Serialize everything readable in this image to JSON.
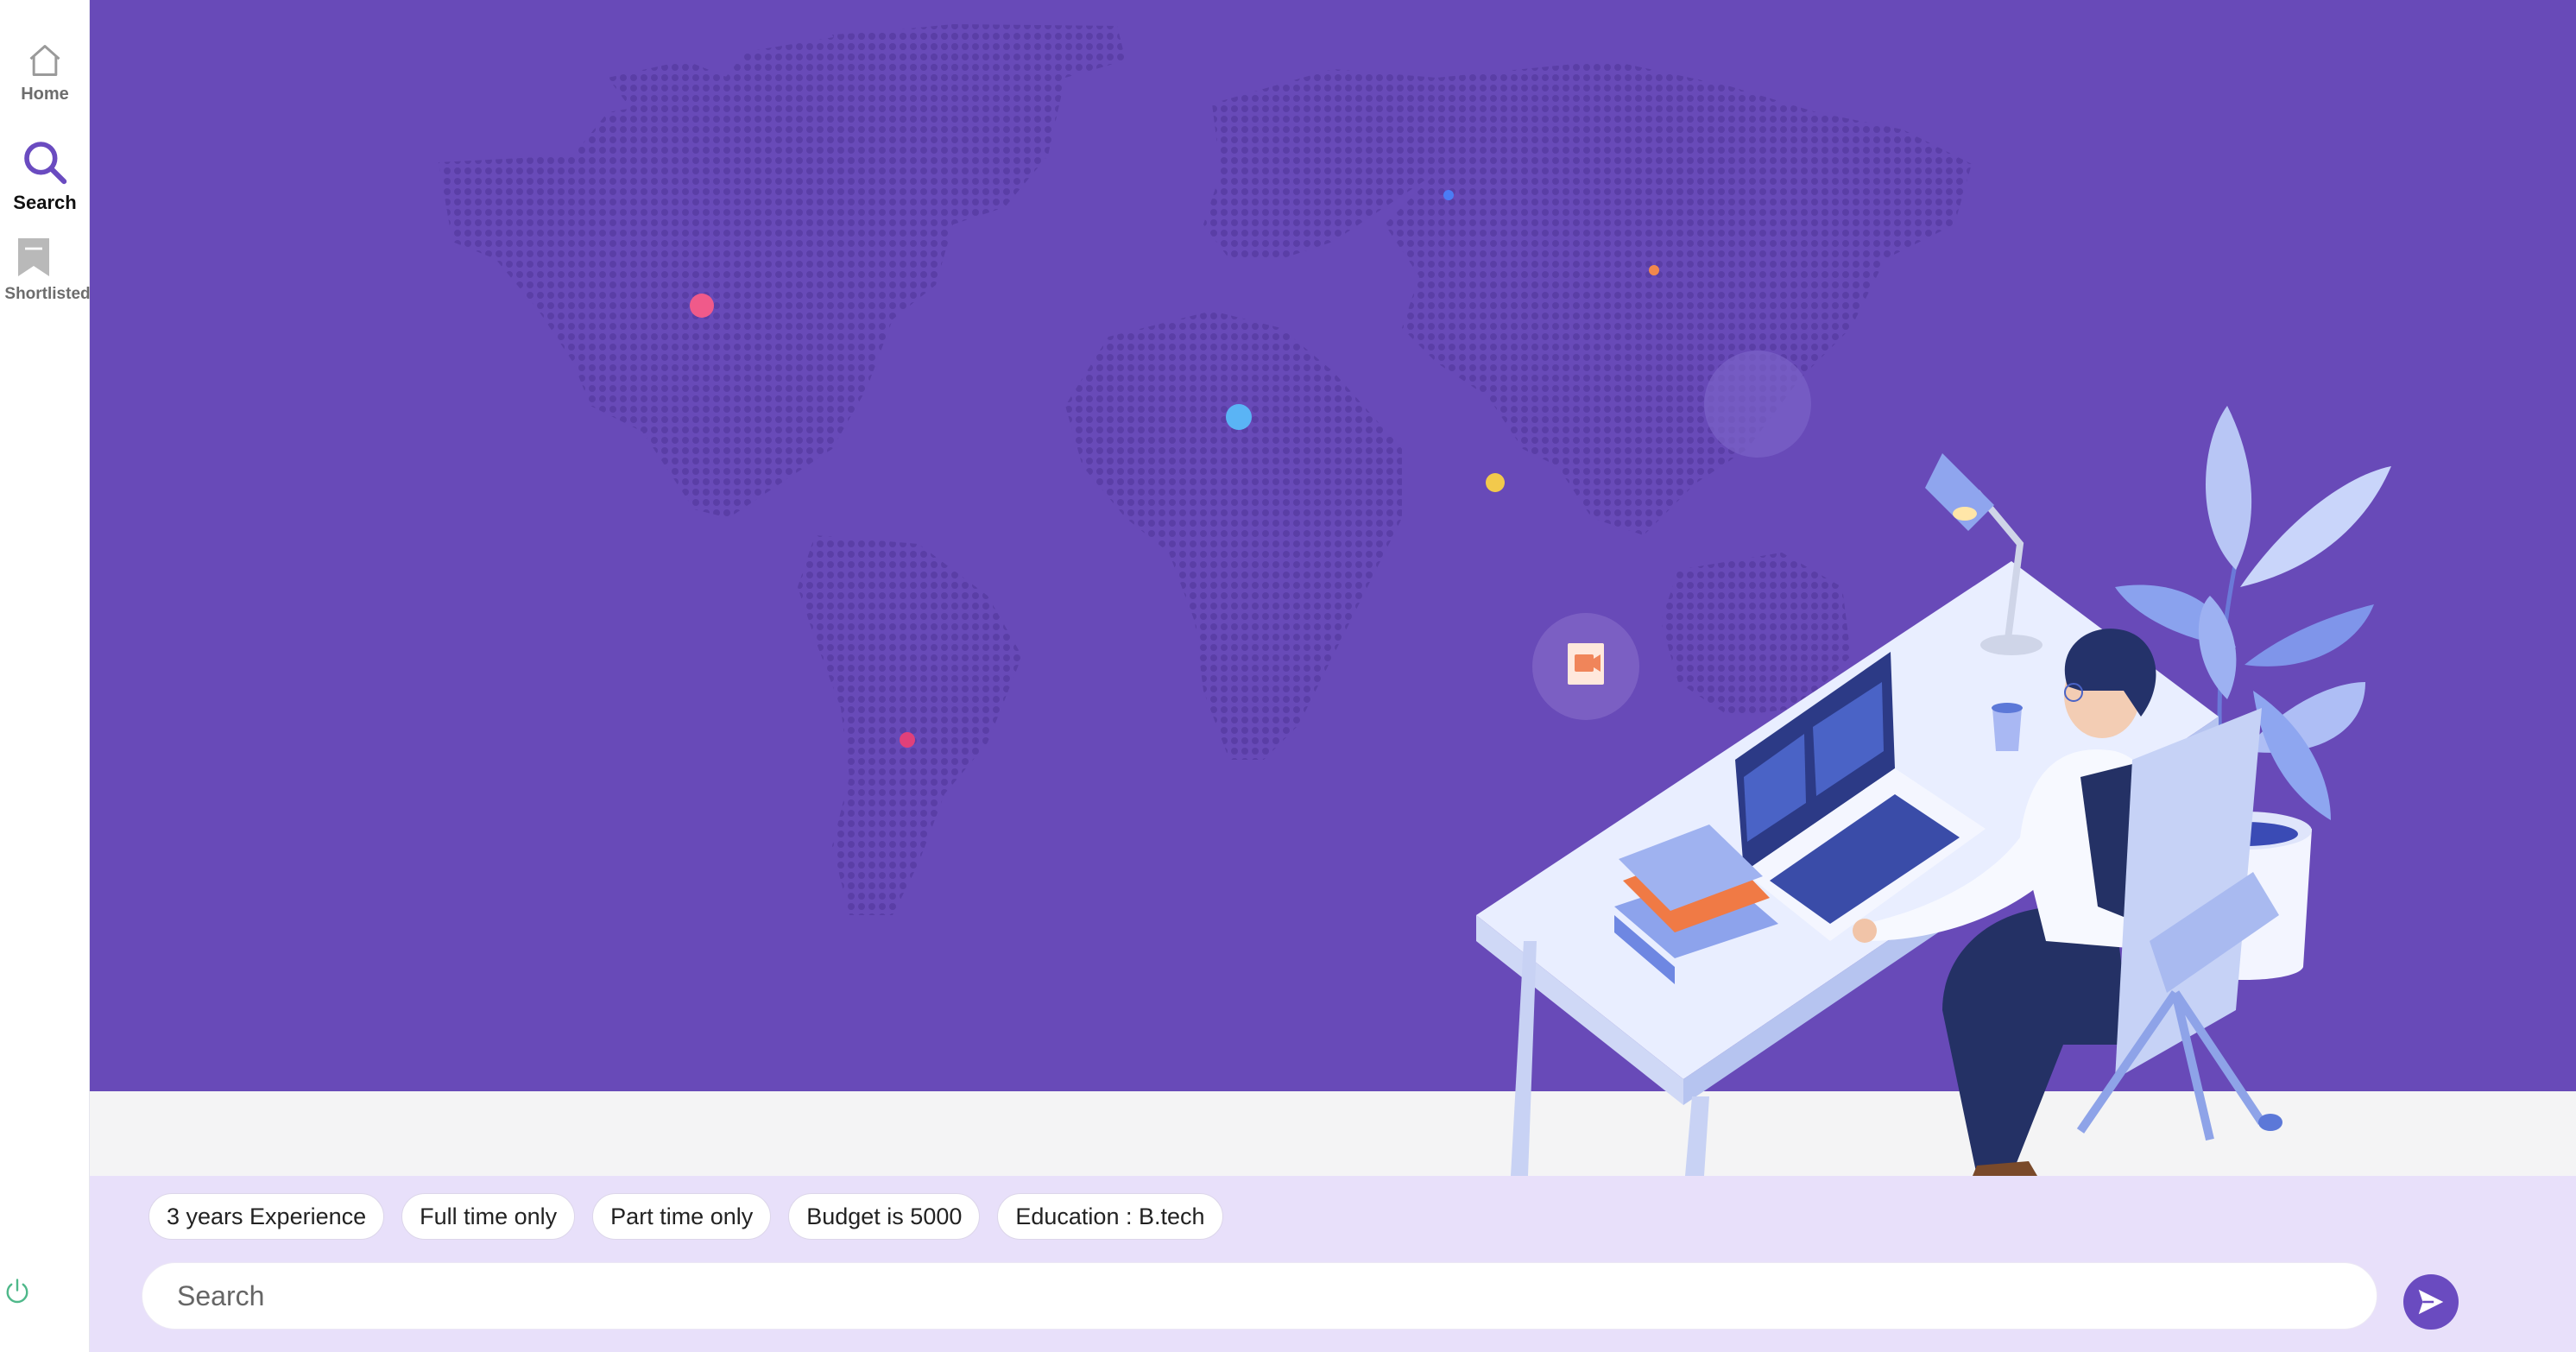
{
  "nav": {
    "home": {
      "label": "Home",
      "icon": "home-icon"
    },
    "search": {
      "label": "Search",
      "icon": "search-icon",
      "active": true
    },
    "shortlisted": {
      "label": "Shortlisted",
      "icon": "bookmark-icon"
    }
  },
  "power": {
    "icon": "power-icon"
  },
  "colors": {
    "hero_bg": "#684ab8",
    "accent": "#6a4bc0",
    "panel_bg": "#e8e0fa",
    "map_dot": "#5a3ea6"
  },
  "filters": [
    {
      "label": "3 years Experience"
    },
    {
      "label": "Full time only"
    },
    {
      "label": "Part time only"
    },
    {
      "label": "Budget is 5000"
    },
    {
      "label": "Education : B.tech"
    }
  ],
  "search": {
    "placeholder": "Search"
  },
  "send": {
    "icon": "send-icon"
  }
}
